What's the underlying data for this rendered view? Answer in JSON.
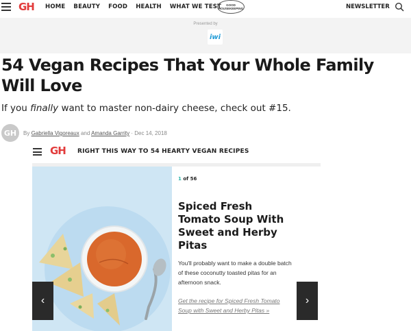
{
  "nav": {
    "items": [
      "HOME",
      "BEAUTY",
      "FOOD",
      "HEALTH",
      "WHAT WE TEST"
    ],
    "logo": "GH",
    "seal_top": "GOOD",
    "seal_bottom": "HOUSEKEEPING",
    "newsletter": "NEWSLETTER"
  },
  "sponsor": {
    "presented_by": "Presented by",
    "logo_text": "iwi"
  },
  "article": {
    "headline": "54 Vegan Recipes That Your Whole Family Will Love",
    "dek_prefix": "If you ",
    "dek_emphasis": "finally",
    "dek_suffix": " want to master non-dairy cheese, check out #15.",
    "byline": {
      "avatar": "GH",
      "by": "By",
      "author1": "Gabriella Vigoreaux",
      "and": "and",
      "author2": "Amanda Garrity",
      "sep": "·",
      "date": "Dec 14, 2018"
    }
  },
  "gallery": {
    "logo": "GH",
    "title": "RIGHT THIS WAY TO 54 HEARTY VEGAN RECIPES",
    "counter_current": "1",
    "counter_rest": "of 56",
    "slide": {
      "title": "Spiced Fresh Tomato Soup With Sweet and Herby Pitas",
      "description": "You'll probably want to make a double batch of these coconutty toasted pitas for an afternoon snack.",
      "link": "Get the recipe for Spiced Fresh Tomato Soup with Sweet and Herby Pitas »"
    },
    "prev_glyph": "‹",
    "next_glyph": "›"
  },
  "colors": {
    "brand_red": "#e23b3b",
    "counter_teal": "#2bb3a8",
    "image_bg": "#cfe6f4",
    "soup": "#d9682c"
  }
}
